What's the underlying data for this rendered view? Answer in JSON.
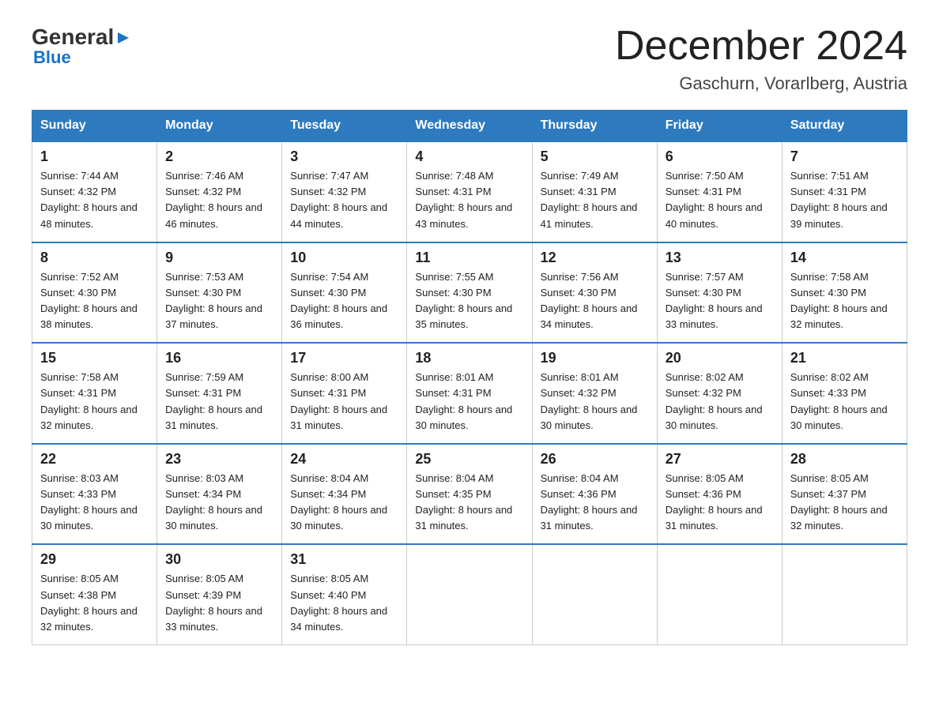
{
  "logo": {
    "text_general": "General",
    "text_blue": "Blue",
    "sub": "Blue"
  },
  "header": {
    "title": "December 2024",
    "location": "Gaschurn, Vorarlberg, Austria"
  },
  "weekdays": [
    "Sunday",
    "Monday",
    "Tuesday",
    "Wednesday",
    "Thursday",
    "Friday",
    "Saturday"
  ],
  "weeks": [
    [
      {
        "day": "1",
        "sunrise": "7:44 AM",
        "sunset": "4:32 PM",
        "daylight": "8 hours and 48 minutes."
      },
      {
        "day": "2",
        "sunrise": "7:46 AM",
        "sunset": "4:32 PM",
        "daylight": "8 hours and 46 minutes."
      },
      {
        "day": "3",
        "sunrise": "7:47 AM",
        "sunset": "4:32 PM",
        "daylight": "8 hours and 44 minutes."
      },
      {
        "day": "4",
        "sunrise": "7:48 AM",
        "sunset": "4:31 PM",
        "daylight": "8 hours and 43 minutes."
      },
      {
        "day": "5",
        "sunrise": "7:49 AM",
        "sunset": "4:31 PM",
        "daylight": "8 hours and 41 minutes."
      },
      {
        "day": "6",
        "sunrise": "7:50 AM",
        "sunset": "4:31 PM",
        "daylight": "8 hours and 40 minutes."
      },
      {
        "day": "7",
        "sunrise": "7:51 AM",
        "sunset": "4:31 PM",
        "daylight": "8 hours and 39 minutes."
      }
    ],
    [
      {
        "day": "8",
        "sunrise": "7:52 AM",
        "sunset": "4:30 PM",
        "daylight": "8 hours and 38 minutes."
      },
      {
        "day": "9",
        "sunrise": "7:53 AM",
        "sunset": "4:30 PM",
        "daylight": "8 hours and 37 minutes."
      },
      {
        "day": "10",
        "sunrise": "7:54 AM",
        "sunset": "4:30 PM",
        "daylight": "8 hours and 36 minutes."
      },
      {
        "day": "11",
        "sunrise": "7:55 AM",
        "sunset": "4:30 PM",
        "daylight": "8 hours and 35 minutes."
      },
      {
        "day": "12",
        "sunrise": "7:56 AM",
        "sunset": "4:30 PM",
        "daylight": "8 hours and 34 minutes."
      },
      {
        "day": "13",
        "sunrise": "7:57 AM",
        "sunset": "4:30 PM",
        "daylight": "8 hours and 33 minutes."
      },
      {
        "day": "14",
        "sunrise": "7:58 AM",
        "sunset": "4:30 PM",
        "daylight": "8 hours and 32 minutes."
      }
    ],
    [
      {
        "day": "15",
        "sunrise": "7:58 AM",
        "sunset": "4:31 PM",
        "daylight": "8 hours and 32 minutes."
      },
      {
        "day": "16",
        "sunrise": "7:59 AM",
        "sunset": "4:31 PM",
        "daylight": "8 hours and 31 minutes."
      },
      {
        "day": "17",
        "sunrise": "8:00 AM",
        "sunset": "4:31 PM",
        "daylight": "8 hours and 31 minutes."
      },
      {
        "day": "18",
        "sunrise": "8:01 AM",
        "sunset": "4:31 PM",
        "daylight": "8 hours and 30 minutes."
      },
      {
        "day": "19",
        "sunrise": "8:01 AM",
        "sunset": "4:32 PM",
        "daylight": "8 hours and 30 minutes."
      },
      {
        "day": "20",
        "sunrise": "8:02 AM",
        "sunset": "4:32 PM",
        "daylight": "8 hours and 30 minutes."
      },
      {
        "day": "21",
        "sunrise": "8:02 AM",
        "sunset": "4:33 PM",
        "daylight": "8 hours and 30 minutes."
      }
    ],
    [
      {
        "day": "22",
        "sunrise": "8:03 AM",
        "sunset": "4:33 PM",
        "daylight": "8 hours and 30 minutes."
      },
      {
        "day": "23",
        "sunrise": "8:03 AM",
        "sunset": "4:34 PM",
        "daylight": "8 hours and 30 minutes."
      },
      {
        "day": "24",
        "sunrise": "8:04 AM",
        "sunset": "4:34 PM",
        "daylight": "8 hours and 30 minutes."
      },
      {
        "day": "25",
        "sunrise": "8:04 AM",
        "sunset": "4:35 PM",
        "daylight": "8 hours and 31 minutes."
      },
      {
        "day": "26",
        "sunrise": "8:04 AM",
        "sunset": "4:36 PM",
        "daylight": "8 hours and 31 minutes."
      },
      {
        "day": "27",
        "sunrise": "8:05 AM",
        "sunset": "4:36 PM",
        "daylight": "8 hours and 31 minutes."
      },
      {
        "day": "28",
        "sunrise": "8:05 AM",
        "sunset": "4:37 PM",
        "daylight": "8 hours and 32 minutes."
      }
    ],
    [
      {
        "day": "29",
        "sunrise": "8:05 AM",
        "sunset": "4:38 PM",
        "daylight": "8 hours and 32 minutes."
      },
      {
        "day": "30",
        "sunrise": "8:05 AM",
        "sunset": "4:39 PM",
        "daylight": "8 hours and 33 minutes."
      },
      {
        "day": "31",
        "sunrise": "8:05 AM",
        "sunset": "4:40 PM",
        "daylight": "8 hours and 34 minutes."
      },
      null,
      null,
      null,
      null
    ]
  ],
  "colors": {
    "header_bg": "#2e7abf",
    "header_text": "#ffffff",
    "border": "#2e7abf",
    "text": "#222222"
  }
}
